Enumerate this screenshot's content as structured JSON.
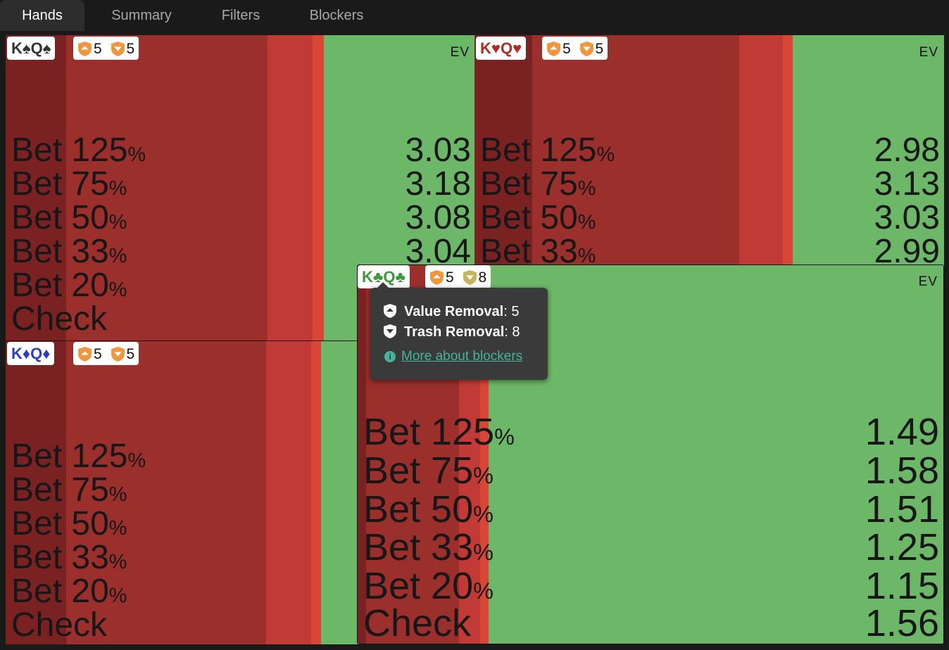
{
  "tabs": [
    {
      "label": "Hands",
      "active": true
    },
    {
      "label": "Summary",
      "active": false
    },
    {
      "label": "Filters",
      "active": false
    },
    {
      "label": "Blockers",
      "active": false
    }
  ],
  "colors": {
    "background": "#1a1a1a",
    "green": "#6cb868",
    "dark_red": "#7a2222",
    "red": "#9a2f2c",
    "bright_red": "#c23a36",
    "orange_red": "#d84636",
    "tooltip": "#3a3a3a",
    "link": "#48b39a",
    "spade": "#333333",
    "heart": "#b52a20",
    "diamond": "#2b3fc4",
    "club": "#3a9a3a",
    "value_shield": "#f0963c",
    "trash_shield_low": "#f0963c",
    "trash_shield_high": "#c8b45a"
  },
  "ev_label": "EV",
  "pct_symbol": "%",
  "panels": [
    {
      "hand": "K♠Q♠",
      "suit": "spade",
      "value_removal": "5",
      "trash_removal": "5",
      "rows": [
        {
          "action": "Bet 125",
          "ev": "3.03"
        },
        {
          "action": "Bet 75",
          "ev": "3.18"
        },
        {
          "action": "Bet 50",
          "ev": "3.08"
        },
        {
          "action": "Bet 33",
          "ev": "3.04"
        },
        {
          "action": "Bet 20",
          "ev": ""
        },
        {
          "action": "Check",
          "ev": ""
        }
      ]
    },
    {
      "hand": "K♥Q♥",
      "suit": "heart",
      "value_removal": "5",
      "trash_removal": "5",
      "rows": [
        {
          "action": "Bet 125",
          "ev": "2.98"
        },
        {
          "action": "Bet 75",
          "ev": "3.13"
        },
        {
          "action": "Bet 50",
          "ev": "3.03"
        },
        {
          "action": "Bet 33",
          "ev": "2.99"
        }
      ]
    },
    {
      "hand": "K♦Q♦",
      "suit": "diamond",
      "value_removal": "5",
      "trash_removal": "5",
      "rows": [
        {
          "action": "Bet 125",
          "ev": ""
        },
        {
          "action": "Bet 75",
          "ev": ""
        },
        {
          "action": "Bet 50",
          "ev": ""
        },
        {
          "action": "Bet 33",
          "ev": ""
        },
        {
          "action": "Bet 20",
          "ev": ""
        },
        {
          "action": "Check",
          "ev": ""
        }
      ]
    },
    {
      "hand": "K♣Q♣",
      "suit": "club",
      "value_removal": "5",
      "trash_removal": "8",
      "rows": [
        {
          "action": "Bet 125",
          "ev": "1.49"
        },
        {
          "action": "Bet 75",
          "ev": "1.58"
        },
        {
          "action": "Bet 50",
          "ev": "1.51"
        },
        {
          "action": "Bet 33",
          "ev": "1.25"
        },
        {
          "action": "Bet 20",
          "ev": "1.15"
        },
        {
          "action": "Check",
          "ev": "1.56"
        }
      ]
    }
  ],
  "tooltip": {
    "value_label": "Value Removal",
    "value": "5",
    "trash_label": "Trash Removal",
    "trash": "8",
    "link": "More about blockers"
  }
}
